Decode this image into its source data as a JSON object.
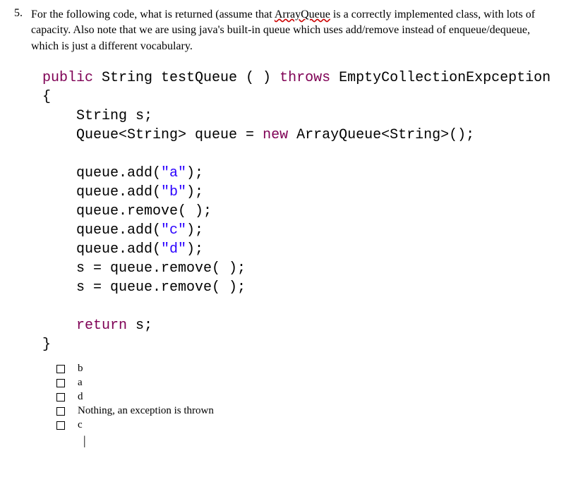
{
  "question": {
    "number": "5.",
    "textBefore": "For the following code, what is returned (assume that ",
    "underlined": "ArrayQueue",
    "textAfter": " is a correctly implemented class, with lots of capacity. Also note that we are using java's built-in queue which uses add/remove instead of enqueue/dequeue, which is just a different vocabulary."
  },
  "code": {
    "l1a": "public",
    "l1b": " String testQueue ( ) ",
    "l1c": "throws",
    "l1d": " EmptyCollectionExpception",
    "l2": "{",
    "l3": "    String s;",
    "l4a": "    Queue<String> queue = ",
    "l4b": "new",
    "l4c": " ArrayQueue<String>();",
    "l5": "",
    "l6a": "    queue.add(",
    "l6b": "\"a\"",
    "l6c": ");",
    "l7a": "    queue.add(",
    "l7b": "\"b\"",
    "l7c": ");",
    "l8": "    queue.remove( );",
    "l9a": "    queue.add(",
    "l9b": "\"c\"",
    "l9c": ");",
    "l10a": "    queue.add(",
    "l10b": "\"d\"",
    "l10c": ");",
    "l11": "    s = queue.remove( );",
    "l12": "    s = queue.remove( );",
    "l13": "",
    "l14a": "    ",
    "l14b": "return",
    "l14c": " s;",
    "l15": "}"
  },
  "options": [
    {
      "label": "b"
    },
    {
      "label": "a"
    },
    {
      "label": "d"
    },
    {
      "label": "Nothing, an exception is thrown"
    },
    {
      "label": "c"
    }
  ],
  "cursor": "|"
}
